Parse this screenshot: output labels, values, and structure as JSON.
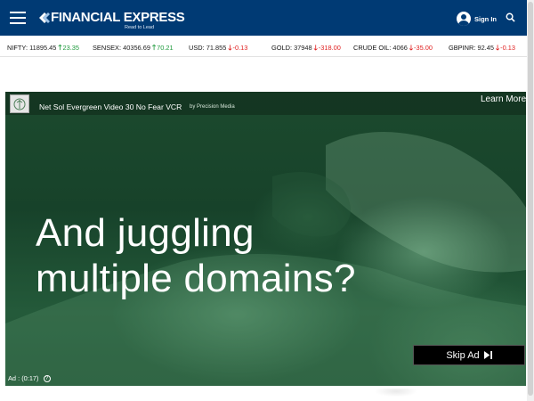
{
  "header": {
    "logo_text": "FINANCIAL EXPRESS",
    "logo_tagline": "Read to Lead",
    "signin_label": "Sign In",
    "bg_color": "#003a74"
  },
  "ticker": [
    {
      "name": "NIFTY:",
      "value": "11895.45",
      "direction": "up",
      "change": "23.35"
    },
    {
      "name": "SENSEX:",
      "value": "40356.69",
      "direction": "up",
      "change": "70.21"
    },
    {
      "name": "USD:",
      "value": "71.855",
      "direction": "down",
      "change": "-0.13"
    },
    {
      "name": "GOLD:",
      "value": "37948",
      "direction": "down",
      "change": "-318.00"
    },
    {
      "name": "CRUDE OIL:",
      "value": "4066",
      "direction": "down",
      "change": "-35.00"
    },
    {
      "name": "GBPINR:",
      "value": "92.45",
      "direction": "down",
      "change": "-0.13"
    }
  ],
  "ad": {
    "title": "Net Sol Evergreen Video 30 No Fear VCR",
    "by_label": "by Precision Media",
    "learn_more": "Learn More",
    "headline_line1": "And juggling",
    "headline_line2": "multiple domains?",
    "skip_label": "Skip Ad",
    "timer": "Ad : (0:17)"
  },
  "icons": {
    "menu": "hamburger-icon",
    "user": "user-icon",
    "search": "search-icon",
    "skip": "skip-next-icon",
    "help": "help-icon"
  }
}
